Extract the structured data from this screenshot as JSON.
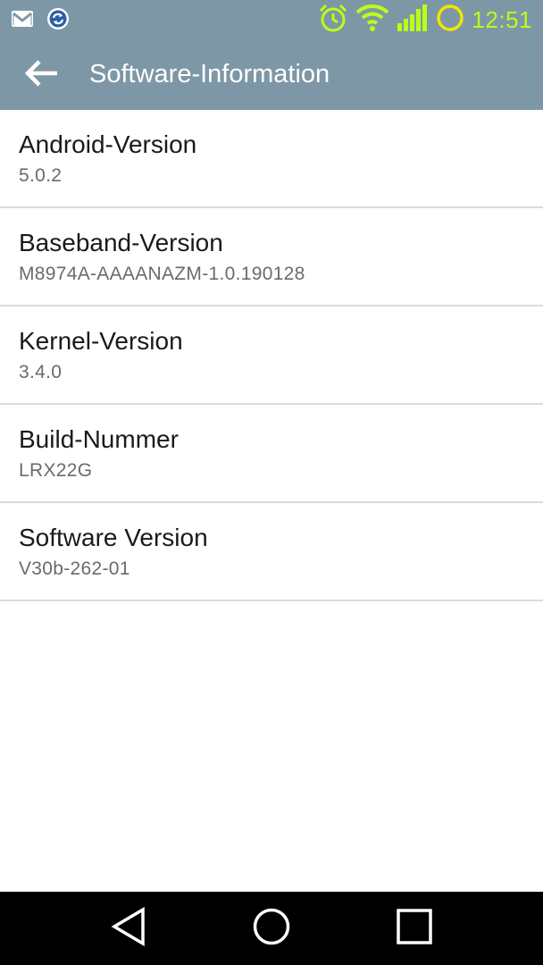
{
  "status_bar": {
    "time": "12:51",
    "icons": [
      "gmail-icon",
      "sync-icon",
      "alarm-icon",
      "wifi-icon",
      "signal-icon",
      "battery-icon"
    ],
    "accent_color": "#b8ff1a"
  },
  "app_bar": {
    "title": "Software-Information",
    "back_icon": "arrow-back-icon",
    "color": "#7e97a6"
  },
  "items": [
    {
      "title": "Android-Version",
      "value": "5.0.2"
    },
    {
      "title": "Baseband-Version",
      "value": "M8974A-AAAANAZM-1.0.190128"
    },
    {
      "title": "Kernel-Version",
      "value": "3.4.0"
    },
    {
      "title": "Build-Nummer",
      "value": "LRX22G"
    },
    {
      "title": "Software Version",
      "value": "V30b-262-01"
    }
  ],
  "nav_bar": {
    "buttons": [
      "back-triangle-icon",
      "home-circle-icon",
      "recents-square-icon"
    ]
  }
}
